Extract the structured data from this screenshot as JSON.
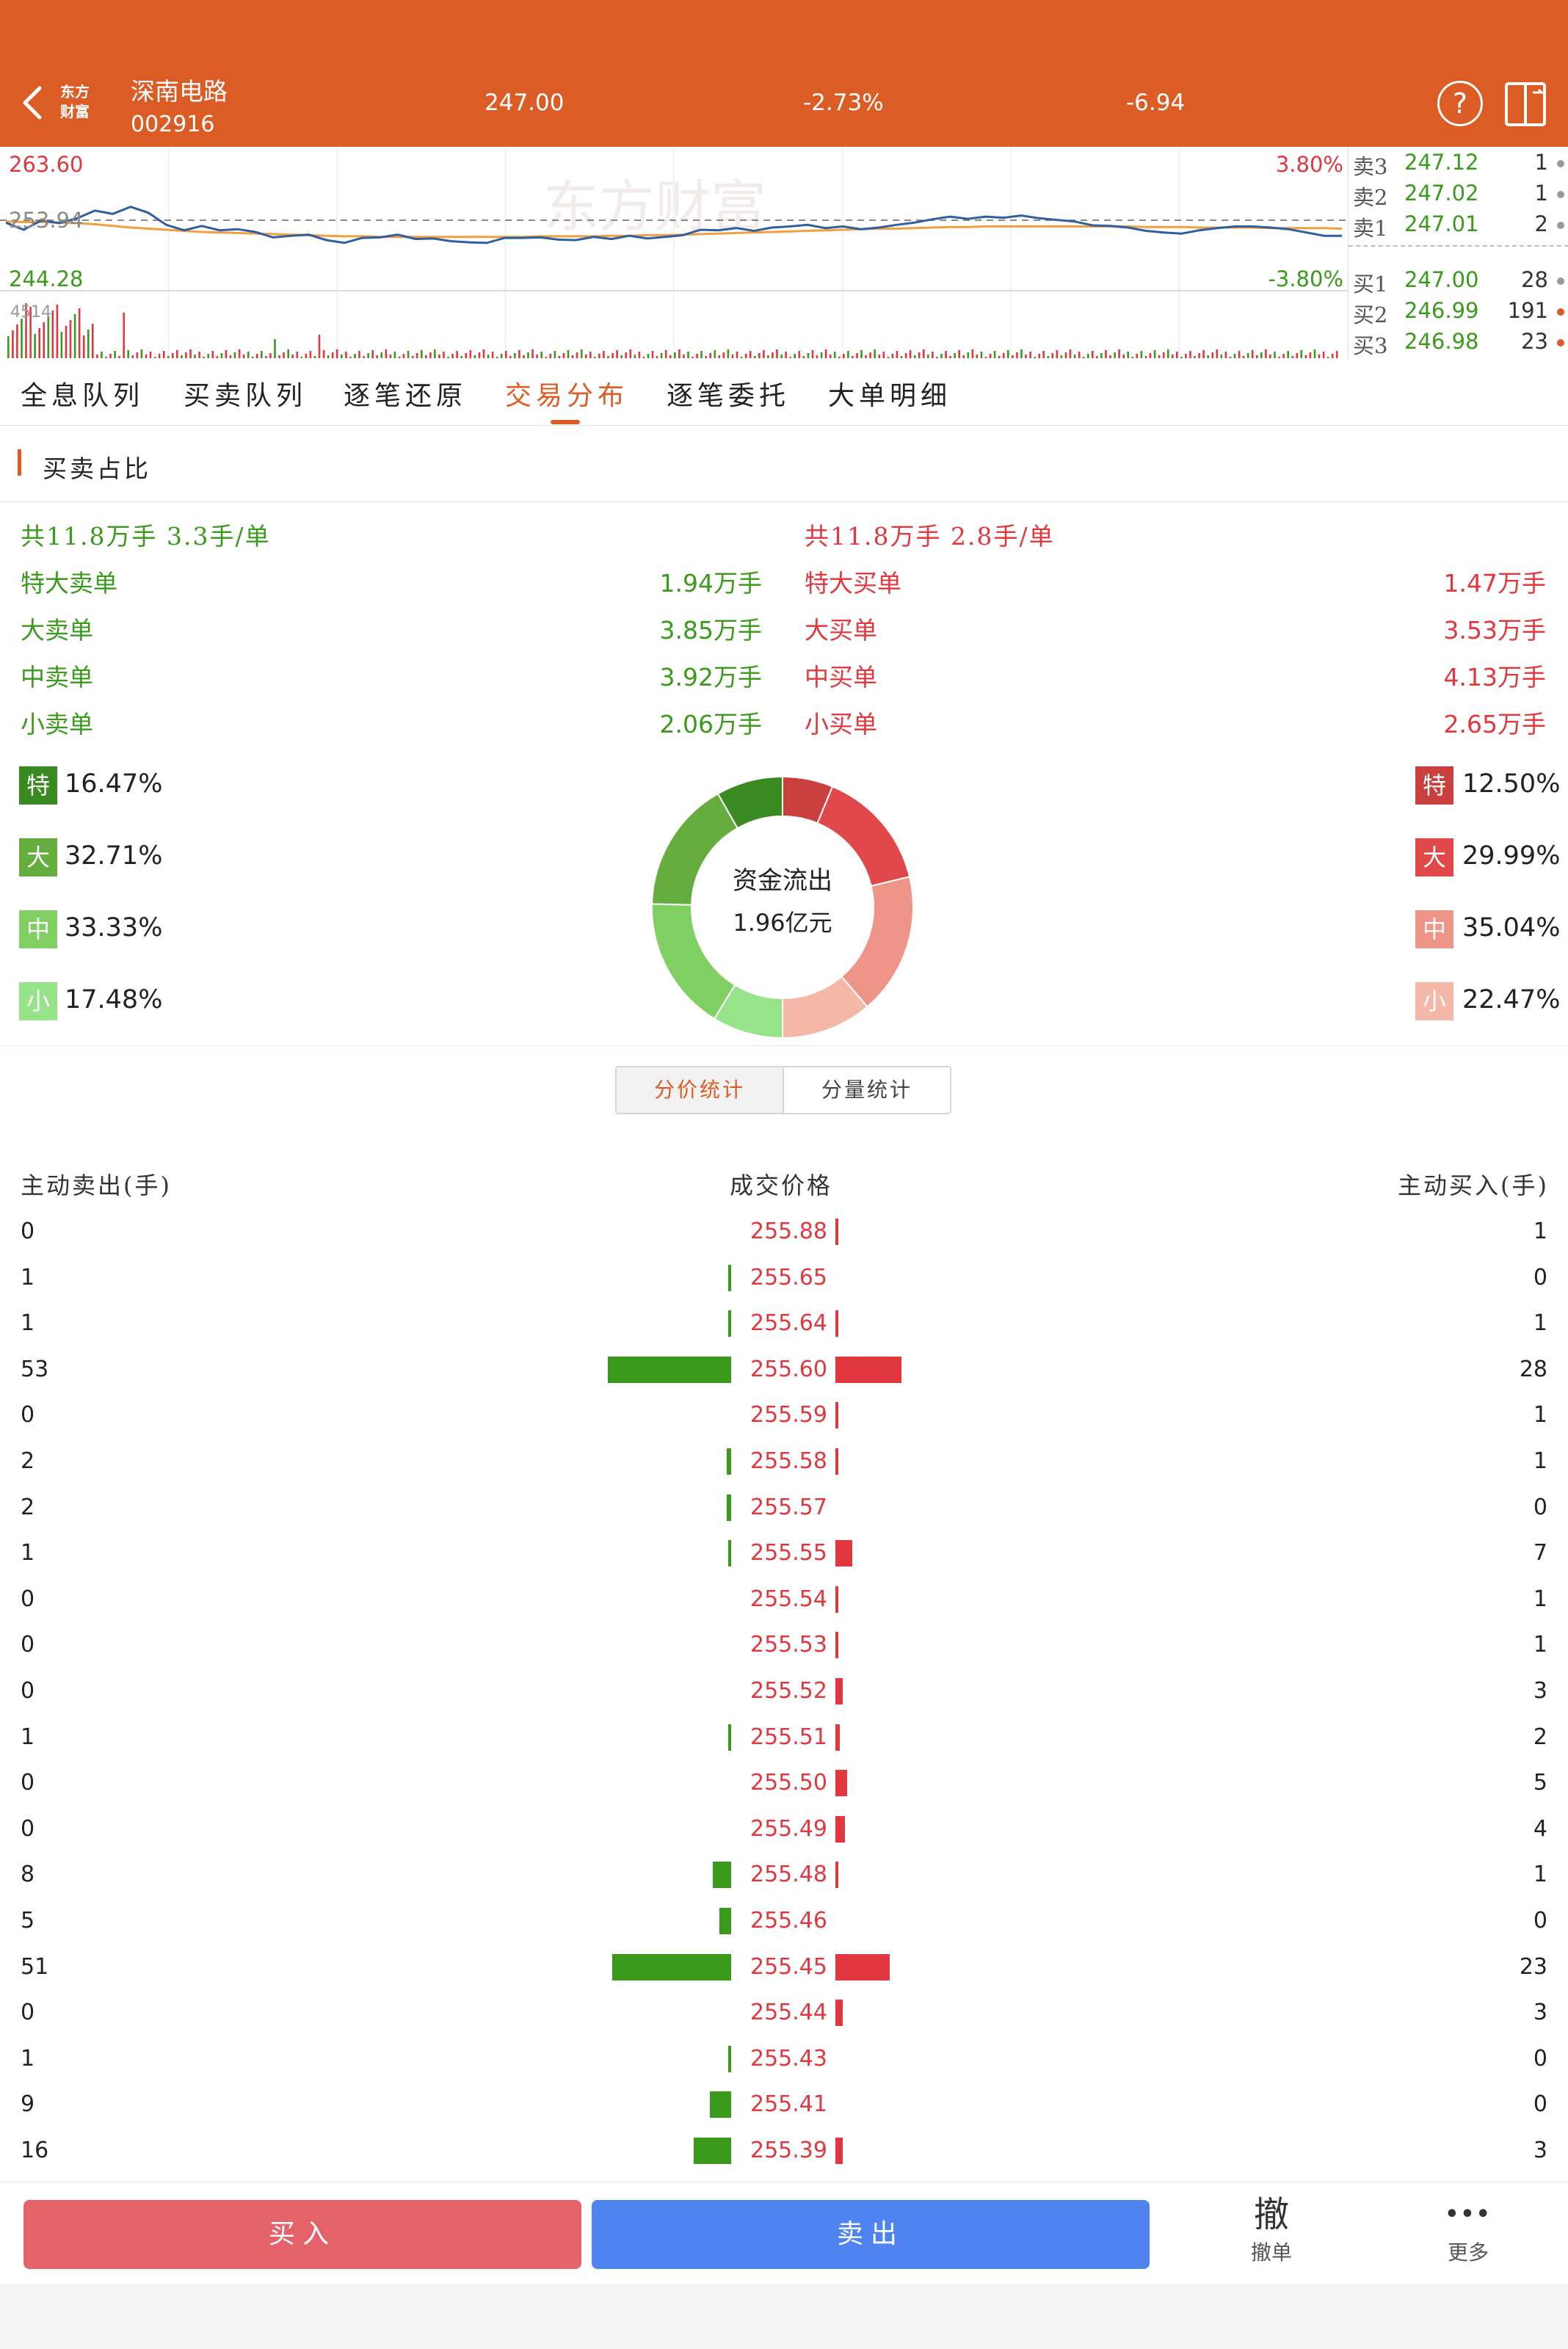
{
  "header": {
    "logo_line1": "东方",
    "logo_line2": "财富",
    "stock_name": "深南电路",
    "stock_code": "002916",
    "price": "247.00",
    "change_pct": "-2.73%",
    "change": "-6.94"
  },
  "intraday": {
    "high_price": "263.60",
    "pre_close": "253.94",
    "low_price": "244.28",
    "high_pct": "3.80%",
    "low_pct": "-3.80%",
    "vol_max": "4514",
    "watermark": "东方财富",
    "price_series": [
      253.5,
      252.2,
      253.9,
      253.4,
      254.3,
      255.7,
      255.1,
      256.4,
      255.3,
      253.1,
      252.1,
      252.9,
      252.1,
      252.3,
      251.8,
      250.8,
      251.1,
      251.3,
      250.3,
      249.8,
      250.7,
      250.8,
      251.3,
      250.5,
      250.6,
      250.1,
      249.9,
      249.8,
      250.7,
      250.7,
      250.8,
      250.4,
      250.3,
      250.9,
      250.5,
      251.1,
      250.6,
      250.9,
      251.2,
      252.2,
      252.1,
      252.5,
      252.0,
      252.6,
      252.8,
      253.1,
      252.5,
      252.8,
      252.3,
      252.6,
      253.1,
      253.5,
      254.1,
      254.6,
      254.2,
      254.6,
      254.4,
      254.8,
      254.3,
      254.0,
      253.7,
      253.0,
      252.9,
      252.6,
      252.0,
      251.7,
      251.5,
      252.1,
      252.5,
      252.8,
      252.8,
      252.6,
      252.3,
      251.7,
      251.1,
      251.1
    ],
    "avg_series": [
      253.7,
      253.6,
      253.6,
      253.5,
      253.4,
      253.2,
      252.9,
      252.6,
      252.4,
      252.2,
      252.0,
      251.8,
      251.7,
      251.6,
      251.5,
      251.4,
      251.3,
      251.2,
      251.1,
      251.0,
      251.0,
      250.9,
      250.9,
      250.9,
      250.9,
      250.9,
      250.9,
      250.9,
      250.9,
      250.9,
      251.0,
      251.0,
      251.0,
      251.0,
      251.1,
      251.1,
      251.2,
      251.2,
      251.3,
      251.4,
      251.5,
      251.6,
      251.7,
      251.8,
      251.9,
      252.0,
      252.1,
      252.2,
      252.3,
      252.4,
      252.4,
      252.5,
      252.6,
      252.7,
      252.7,
      252.8,
      252.8,
      252.8,
      252.8,
      252.8,
      252.8,
      252.8,
      252.8,
      252.8,
      252.7,
      252.7,
      252.7,
      252.6,
      252.6,
      252.6,
      252.6,
      252.5,
      252.5,
      252.5,
      252.5,
      252.4
    ]
  },
  "orderbook": [
    {
      "label": "卖3",
      "price": "247.12",
      "qty": "1",
      "dot": "#9a9a9a"
    },
    {
      "label": "卖2",
      "price": "247.02",
      "qty": "1",
      "dot": "#9a9a9a"
    },
    {
      "label": "卖1",
      "price": "247.01",
      "qty": "2",
      "dot": "#9a9a9a"
    },
    {
      "label": "买1",
      "price": "247.00",
      "qty": "28",
      "dot": "#9a9a9a"
    },
    {
      "label": "买2",
      "price": "246.99",
      "qty": "191",
      "dot": "#e05a2a"
    },
    {
      "label": "买3",
      "price": "246.98",
      "qty": "23",
      "dot": "#e05a2a"
    }
  ],
  "tabs": [
    "全息队列",
    "买卖队列",
    "逐笔还原",
    "交易分布",
    "逐笔委托",
    "大单明细"
  ],
  "active_tab": 3,
  "section_title": "买卖占比",
  "sell_side": {
    "summary": "共11.8万手 3.3手/单",
    "rows": [
      {
        "label": "特大卖单",
        "value": "1.94万手"
      },
      {
        "label": "大卖单",
        "value": "3.85万手"
      },
      {
        "label": "中卖单",
        "value": "3.92万手"
      },
      {
        "label": "小卖单",
        "value": "2.06万手"
      }
    ]
  },
  "buy_side": {
    "summary": "共11.8万手 2.8手/单",
    "rows": [
      {
        "label": "特大买单",
        "value": "1.47万手"
      },
      {
        "label": "大买单",
        "value": "3.53万手"
      },
      {
        "label": "中买单",
        "value": "4.13万手"
      },
      {
        "label": "小买单",
        "value": "2.65万手"
      }
    ]
  },
  "donut": {
    "center_title": "资金流出",
    "center_value": "1.96亿元",
    "sell_legend": [
      {
        "tag": "特",
        "pct": "16.47%",
        "color": "#3a8a22"
      },
      {
        "tag": "大",
        "pct": "32.71%",
        "color": "#66ad3f"
      },
      {
        "tag": "中",
        "pct": "33.33%",
        "color": "#7fcf62"
      },
      {
        "tag": "小",
        "pct": "17.48%",
        "color": "#96e38a"
      }
    ],
    "buy_legend": [
      {
        "tag": "特",
        "pct": "12.50%",
        "color": "#c9403e"
      },
      {
        "tag": "大",
        "pct": "29.99%",
        "color": "#e0484a"
      },
      {
        "tag": "中",
        "pct": "35.04%",
        "color": "#ee9488"
      },
      {
        "tag": "小",
        "pct": "22.47%",
        "color": "#f5b8a8"
      }
    ]
  },
  "toggle": {
    "left": "分价统计",
    "right": "分量统计"
  },
  "table": {
    "headers": {
      "sell": "主动卖出(手)",
      "price": "成交价格",
      "buy": "主动买入(手)"
    },
    "rows": [
      {
        "sell": 0,
        "price": "255.88",
        "buy": 1
      },
      {
        "sell": 1,
        "price": "255.65",
        "buy": 0
      },
      {
        "sell": 1,
        "price": "255.64",
        "buy": 1
      },
      {
        "sell": 53,
        "price": "255.60",
        "buy": 28
      },
      {
        "sell": 0,
        "price": "255.59",
        "buy": 1
      },
      {
        "sell": 2,
        "price": "255.58",
        "buy": 1
      },
      {
        "sell": 2,
        "price": "255.57",
        "buy": 0
      },
      {
        "sell": 1,
        "price": "255.55",
        "buy": 7
      },
      {
        "sell": 0,
        "price": "255.54",
        "buy": 1
      },
      {
        "sell": 0,
        "price": "255.53",
        "buy": 1
      },
      {
        "sell": 0,
        "price": "255.52",
        "buy": 3
      },
      {
        "sell": 1,
        "price": "255.51",
        "buy": 2
      },
      {
        "sell": 0,
        "price": "255.50",
        "buy": 5
      },
      {
        "sell": 0,
        "price": "255.49",
        "buy": 4
      },
      {
        "sell": 8,
        "price": "255.48",
        "buy": 1
      },
      {
        "sell": 5,
        "price": "255.46",
        "buy": 0
      },
      {
        "sell": 51,
        "price": "255.45",
        "buy": 23
      },
      {
        "sell": 0,
        "price": "255.44",
        "buy": 3
      },
      {
        "sell": 1,
        "price": "255.43",
        "buy": 0
      },
      {
        "sell": 9,
        "price": "255.41",
        "buy": 0
      },
      {
        "sell": 16,
        "price": "255.39",
        "buy": 3
      }
    ]
  },
  "bottom": {
    "buy_label": "买入",
    "sell_label": "卖出",
    "cancel_icon_glyph": "撤",
    "cancel_label": "撤单",
    "more_icon_glyph": "•••",
    "more_label": "更多"
  }
}
